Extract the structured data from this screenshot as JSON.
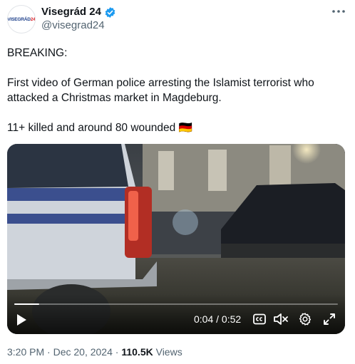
{
  "author": {
    "display_name": "Visegrád 24",
    "handle": "@visegrad24",
    "avatar_text_a": "VISEGRÁD",
    "avatar_text_b": "24"
  },
  "tweet": {
    "text": "BREAKING:\n\nFirst video of German police arresting the Islamist terrorist who attacked a Christmas market in Magdeburg.\n\n11+ killed and around 80 wounded 🇩🇪"
  },
  "video": {
    "current_time": "0:04",
    "separator": " / ",
    "duration": "0:52",
    "progress_fraction": 0.077
  },
  "meta": {
    "time": "3:20 PM",
    "dot1": " · ",
    "date": "Dec 20, 2024",
    "dot2": " · ",
    "views_count": "110.5K",
    "views_label": " Views"
  },
  "colors": {
    "verified": "#1d9bf0",
    "muted_text": "#536471",
    "brand_blue": "#1d3f8a",
    "brand_red": "#d8232a"
  }
}
